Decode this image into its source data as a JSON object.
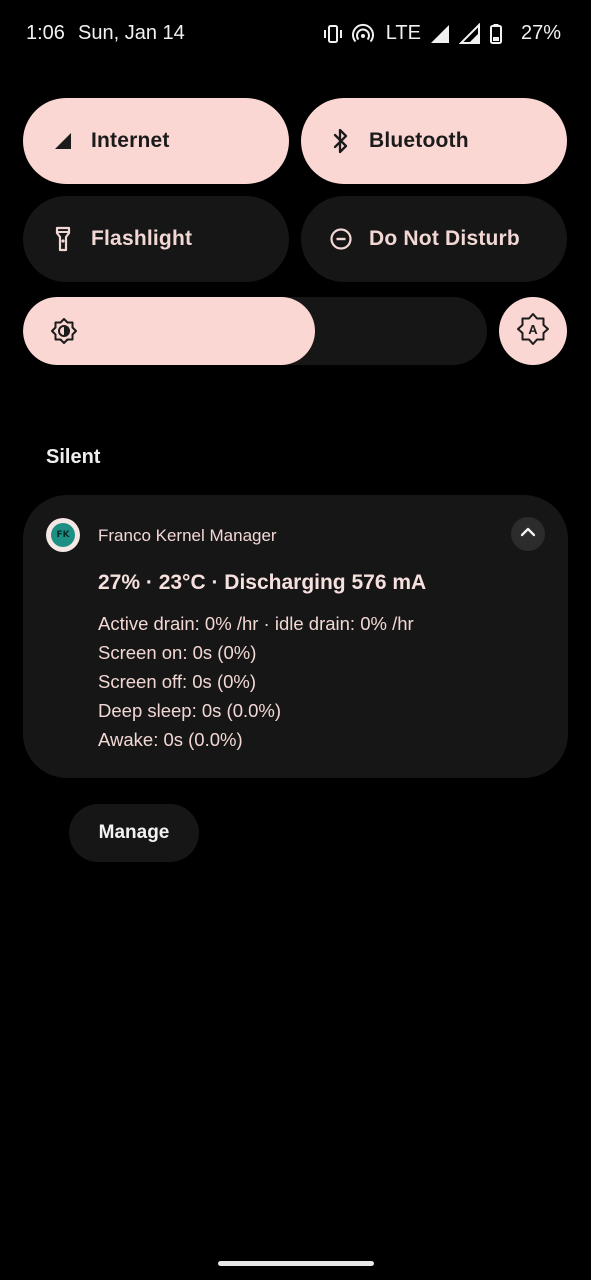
{
  "status_bar": {
    "time": "1:06",
    "date": "Sun, Jan 14",
    "network_type": "LTE",
    "battery_percent": "27%",
    "icons": [
      "vibrate-icon",
      "hotspot-icon",
      "signal-icon",
      "signal-icon",
      "battery-icon"
    ]
  },
  "quick_settings": {
    "tiles": [
      {
        "label": "Internet",
        "icon": "cellular-signal-icon",
        "state": "on"
      },
      {
        "label": "Bluetooth",
        "icon": "bluetooth-icon",
        "state": "on"
      },
      {
        "label": "Flashlight",
        "icon": "flashlight-icon",
        "state": "off"
      },
      {
        "label": "Do Not Disturb",
        "icon": "do-not-disturb-icon",
        "state": "off"
      }
    ],
    "brightness_level": 0.63,
    "auto_brightness_icon": "auto-brightness-icon"
  },
  "notifications": {
    "section_label": "Silent",
    "items": [
      {
        "app_name": "Franco Kernel Manager",
        "app_icon_text": "FK",
        "title": "27% · 23°C · Discharging 576 mA",
        "lines": [
          "Active drain: 0% /hr · idle drain: 0% /hr",
          "Screen on: 0s (0%)",
          "Screen off: 0s (0%)",
          "Deep sleep: 0s (0.0%)",
          "Awake: 0s (0.0%)"
        ]
      }
    ],
    "manage_label": "Manage"
  },
  "colors": {
    "tile_on": "#fbd7d4",
    "tile_off": "#161616",
    "text_on_dark": "#f2d8d4",
    "background": "#000000"
  }
}
